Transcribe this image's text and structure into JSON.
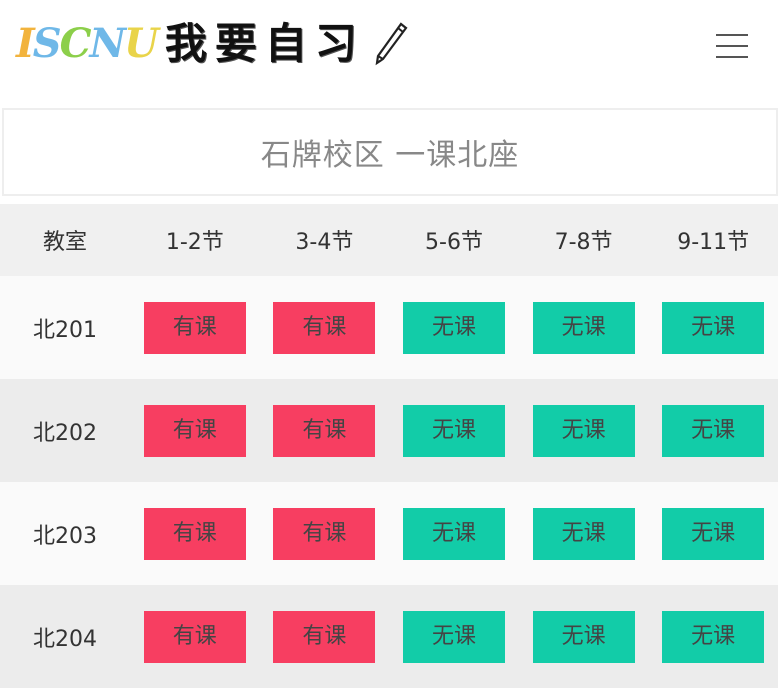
{
  "header": {
    "logo_text": [
      "I",
      "S",
      "C",
      "N",
      "U"
    ],
    "app_title": "我要自习",
    "pencil_icon": "pencil-icon",
    "menu_icon": "hamburger-menu-icon"
  },
  "campus": {
    "title": "石牌校区 一课北座"
  },
  "schedule": {
    "columns": [
      "教室",
      "1-2节",
      "3-4节",
      "5-6节",
      "7-8节",
      "9-11节"
    ],
    "rows": [
      {
        "room": "北201",
        "slots": [
          "有课",
          "有课",
          "无课",
          "无课",
          "无课"
        ]
      },
      {
        "room": "北202",
        "slots": [
          "有课",
          "有课",
          "无课",
          "无课",
          "无课"
        ]
      },
      {
        "room": "北203",
        "slots": [
          "有课",
          "有课",
          "无课",
          "无课",
          "无课"
        ]
      },
      {
        "room": "北204",
        "slots": [
          "有课",
          "有课",
          "无课",
          "无课",
          "无课"
        ]
      }
    ]
  },
  "colors": {
    "busy": "#f73e61",
    "free": "#12cca8",
    "header_bg": "#f0f0f0"
  }
}
